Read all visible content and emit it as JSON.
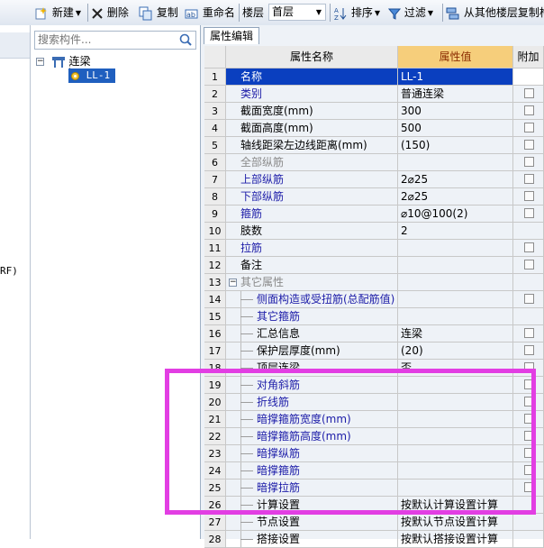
{
  "toolbar": {
    "new_label": "新建",
    "delete_label": "删除",
    "copy_label": "复制",
    "rename_label": "重命名",
    "floor_label": "楼层",
    "floor_value": "首层",
    "sort_label": "排序",
    "filter_label": "过滤",
    "copy_from_floor_label": "从其他楼层复制构"
  },
  "left_strip": {
    "partial_text": "RF)"
  },
  "tree": {
    "search_placeholder": "搜索构件...",
    "root_label": "连梁",
    "child_label": "LL-1"
  },
  "properties": {
    "tab_label": "属性编辑",
    "headers": {
      "name": "属性名称",
      "value": "属性值",
      "extra": "附加"
    },
    "rows": [
      {
        "num": "1",
        "name": "名称",
        "value": "LL-1",
        "checkbox": false
      },
      {
        "num": "2",
        "name": "类别",
        "value": "普通连梁",
        "checkbox": true
      },
      {
        "num": "3",
        "name": "截面宽度(mm)",
        "value": "300",
        "checkbox": true
      },
      {
        "num": "4",
        "name": "截面高度(mm)",
        "value": "500",
        "checkbox": true
      },
      {
        "num": "5",
        "name": "轴线距梁左边线距离(mm)",
        "value": "(150)",
        "checkbox": true
      },
      {
        "num": "6",
        "name": "全部纵筋",
        "value": "",
        "checkbox": true
      },
      {
        "num": "7",
        "name": "上部纵筋",
        "value": "2⌀25",
        "checkbox": true
      },
      {
        "num": "8",
        "name": "下部纵筋",
        "value": "2⌀25",
        "checkbox": true
      },
      {
        "num": "9",
        "name": "箍筋",
        "value": "⌀10@100(2)",
        "checkbox": true
      },
      {
        "num": "10",
        "name": "肢数",
        "value": "2",
        "checkbox": false
      },
      {
        "num": "11",
        "name": "拉筋",
        "value": "",
        "checkbox": true
      },
      {
        "num": "12",
        "name": "备注",
        "value": "",
        "checkbox": true
      },
      {
        "num": "13",
        "name": "其它属性",
        "value": "",
        "checkbox": false
      },
      {
        "num": "14",
        "name": "侧面构造或受扭筋(总配筋值)",
        "value": "",
        "checkbox": true
      },
      {
        "num": "15",
        "name": "其它箍筋",
        "value": "",
        "checkbox": false
      },
      {
        "num": "16",
        "name": "汇总信息",
        "value": "连梁",
        "checkbox": true
      },
      {
        "num": "17",
        "name": "保护层厚度(mm)",
        "value": "(20)",
        "checkbox": true
      },
      {
        "num": "18",
        "name": "顶层连梁",
        "value": "否",
        "checkbox": true
      },
      {
        "num": "19",
        "name": "对角斜筋",
        "value": "",
        "checkbox": true
      },
      {
        "num": "20",
        "name": "折线筋",
        "value": "",
        "checkbox": true
      },
      {
        "num": "21",
        "name": "暗撑箍筋宽度(mm)",
        "value": "",
        "checkbox": true
      },
      {
        "num": "22",
        "name": "暗撑箍筋高度(mm)",
        "value": "",
        "checkbox": true
      },
      {
        "num": "23",
        "name": "暗撑纵筋",
        "value": "",
        "checkbox": true
      },
      {
        "num": "24",
        "name": "暗撑箍筋",
        "value": "",
        "checkbox": true
      },
      {
        "num": "25",
        "name": "暗撑拉筋",
        "value": "",
        "checkbox": true
      },
      {
        "num": "26",
        "name": "计算设置",
        "value": "按默认计算设置计算",
        "checkbox": false
      },
      {
        "num": "27",
        "name": "节点设置",
        "value": "按默认节点设置计算",
        "checkbox": false
      },
      {
        "num": "28",
        "name": "搭接设置",
        "value": "按默认搭接设置计算",
        "checkbox": false
      }
    ]
  },
  "colors": {
    "header_value_bg": "#f6ce7b",
    "selection": "#0a3fbf",
    "highlight_box": "#e23ee3",
    "link_text": "#1c1ca8"
  }
}
